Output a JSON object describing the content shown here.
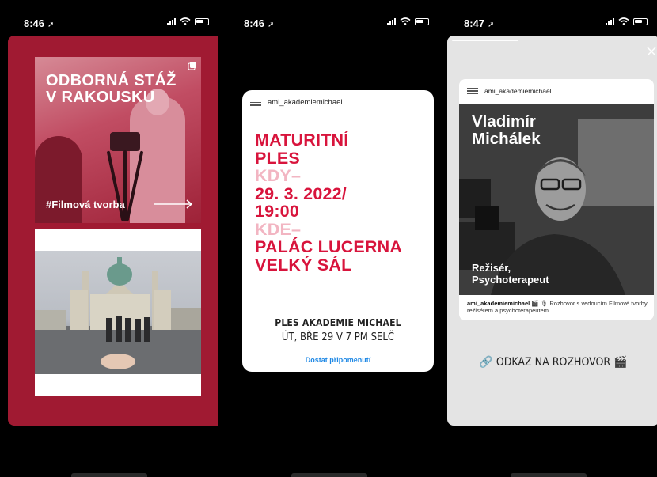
{
  "phones": [
    {
      "status": {
        "time": "8:46"
      },
      "story": {
        "title_lines": [
          "ODBORNÁ STÁŽ",
          "V RAKOUSKU"
        ],
        "tag": "#Filmová tvorba",
        "accent_color": "#a01a32"
      }
    },
    {
      "status": {
        "time": "8:46"
      },
      "post": {
        "username": "ami_akademiemichael",
        "lines": [
          {
            "text": "MATURITNÍ",
            "color": "red"
          },
          {
            "text": "PLES",
            "color": "red"
          },
          {
            "text": "KDY–",
            "color": "pink"
          },
          {
            "text": "29. 3. 2022/",
            "color": "red"
          },
          {
            "text": "19:00",
            "color": "red"
          },
          {
            "text": "KDE–",
            "color": "pink"
          },
          {
            "text": "PALÁC LUCERNA",
            "color": "red"
          },
          {
            "text": "VELKÝ SÁL",
            "color": "red"
          }
        ],
        "event_title": "PLES AKADEMIE MICHAEL",
        "event_time": "ÚT, BŘE 29 V 7 PM SELČ",
        "reminder": "Dostat připomenutí"
      }
    },
    {
      "status": {
        "time": "8:47"
      },
      "post": {
        "username": "ami_akademiemichael",
        "name_lines": [
          "Vladimír",
          "Michálek"
        ],
        "role_lines": [
          "Režisér,",
          "Psychoterapeut"
        ],
        "caption_user": "ami_akademiemichael",
        "caption_text": " 🎬 🎙 Rozhovor s vedoucím Filmové tvorby režisérem a psychoterapeutem...",
        "link_label": "ODKAZ NA ROZHOVOR",
        "link_icon": "🎬"
      }
    }
  ],
  "colors": {
    "brand_red": "#d8143c",
    "pink": "#f2b5c2",
    "link_blue": "#1e88e5"
  }
}
